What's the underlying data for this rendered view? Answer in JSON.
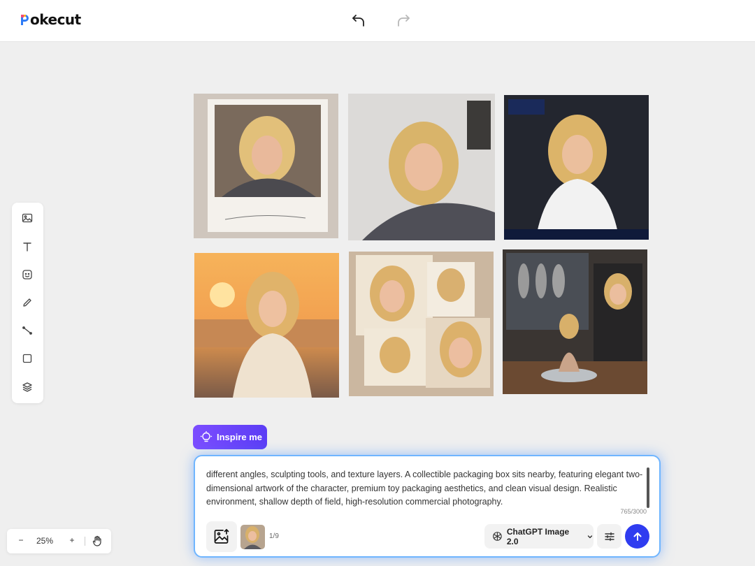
{
  "app": {
    "logo_text": "okecut",
    "logo_full": "Pokecut"
  },
  "header": {
    "undo_icon": "undo-icon",
    "redo_icon": "redo-icon"
  },
  "toolbar": {
    "tools": [
      "image-icon",
      "text-icon",
      "sticker-icon",
      "pen-icon",
      "line-icon",
      "rectangle-icon",
      "layers-icon"
    ]
  },
  "gallery": {
    "images": [
      "polaroid-portrait",
      "couch-portrait",
      "stadium-portrait",
      "sunset-beach-portrait",
      "scrapbook-collage",
      "figurine-studio"
    ]
  },
  "inspire": {
    "label": "Inspire me"
  },
  "prompt": {
    "text": "different angles, sculpting tools, and texture layers. A collectible packaging box sits nearby, featuring elegant two-dimensional artwork of the character, premium toy packaging aesthetics, and clean visual design. Realistic environment, shallow depth of field, high-resolution commercial photography.",
    "char_count": "765/3000",
    "image_count": "1/9",
    "model_label": "ChatGPT Image 2.0"
  },
  "zoom": {
    "minus": "−",
    "level": "25%",
    "plus": "+"
  },
  "colors": {
    "accent": "#2f3cf0",
    "inspire_gradient_start": "#7c4dff",
    "prompt_glow": "#6fb5ff",
    "canvas_bg": "#efefef"
  }
}
